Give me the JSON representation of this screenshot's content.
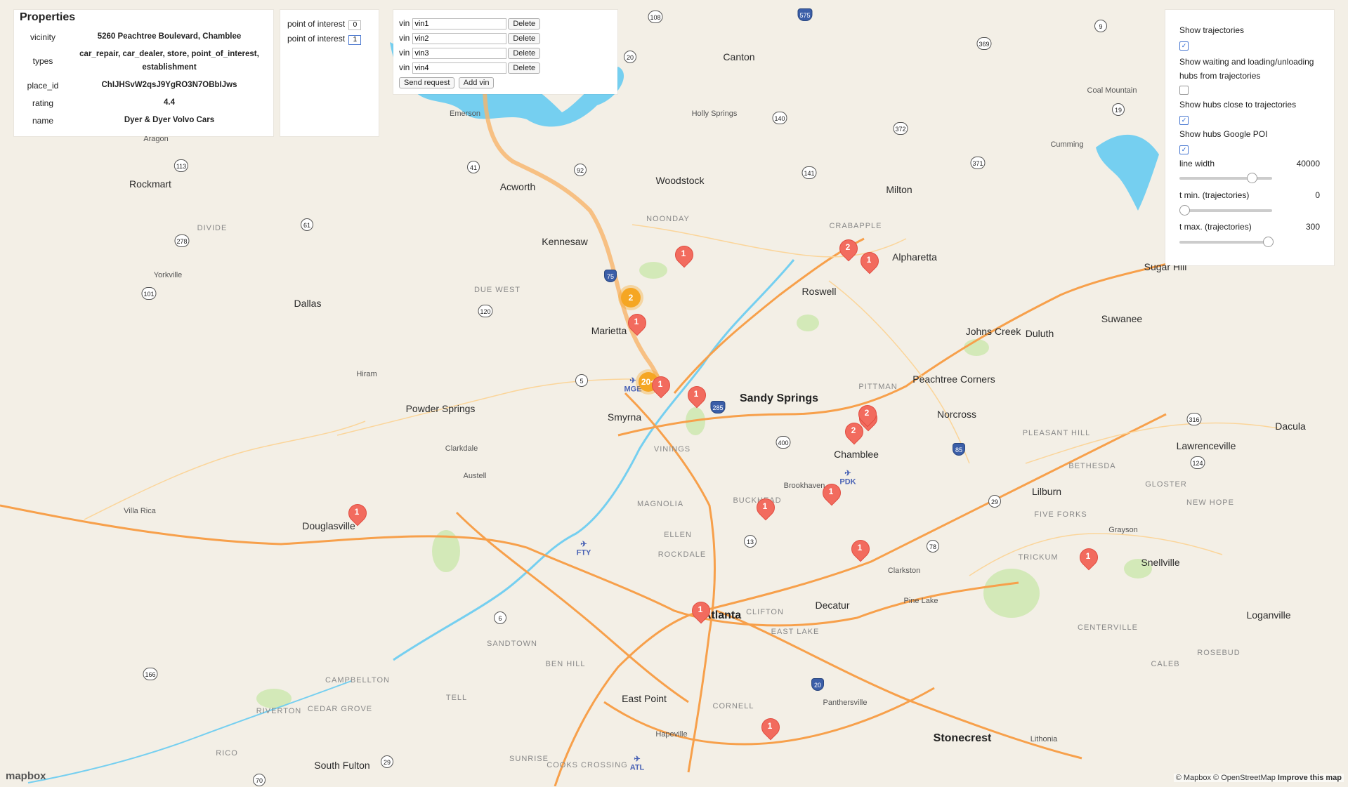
{
  "properties": {
    "title": "Properties",
    "rows": [
      {
        "key": "vicinity",
        "value": "5260 Peachtree Boulevard, Chamblee"
      },
      {
        "key": "types",
        "value": "car_repair, car_dealer, store, point_of_interest, establishment"
      },
      {
        "key": "place_id",
        "value": "ChIJHSvW2qsJ9YgRO3N7OBbIJws"
      },
      {
        "key": "rating",
        "value": "4.4"
      },
      {
        "key": "name",
        "value": "Dyer & Dyer Volvo Cars"
      }
    ]
  },
  "poi": {
    "label": "point of interest",
    "values": [
      "0",
      "1"
    ]
  },
  "vins": {
    "label": "vin",
    "items": [
      "vin1",
      "vin2",
      "vin3",
      "vin4"
    ],
    "delete_label": "Delete",
    "send_label": "Send request",
    "add_label": "Add vin"
  },
  "controls": {
    "show_trajectories": "Show trajectories",
    "show_waiting": "Show waiting and loading/unloading hubs from trajectories",
    "show_hubs_close": "Show hubs close to trajectories",
    "show_hubs_google": "Show hubs Google POI",
    "checked": [
      true,
      false,
      true,
      true
    ],
    "line_width_label": "line width",
    "line_width_value": "40000",
    "line_width_fraction": 0.81,
    "tmin_label": "t min. (trajectories)",
    "tmin_value": "0",
    "tmin_fraction": 0.0,
    "tmax_label": "t max. (trajectories)",
    "tmax_value": "300",
    "tmax_fraction": 1.0
  },
  "map": {
    "places_big": [
      "Sandy Springs",
      "Atlanta",
      "Stonecrest"
    ],
    "places_med": [
      "Marietta",
      "Kennesaw",
      "Smyrna",
      "Roswell",
      "Alpharetta",
      "Dallas",
      "Powder Springs",
      "Douglasville",
      "Chamblee",
      "Norcross",
      "Duluth",
      "Johns Creek",
      "Decatur",
      "East Point",
      "Lilburn",
      "Snellville",
      "Lawrenceville",
      "Dacula",
      "Suwanee",
      "Sugar Hill",
      "Woodstock",
      "Acworth",
      "Canton",
      "Milton",
      "Rockmart",
      "South Fulton",
      "Loganville",
      "Peachtree Corners"
    ],
    "places_sm": [
      "Hiram",
      "Clarkdale",
      "Austell",
      "Villa Rica",
      "Yorkville",
      "Aragon",
      "Emerson",
      "Holly Springs",
      "Cumming",
      "Coal Mountain",
      "Brookhaven",
      "Clarkston",
      "Pine Lake",
      "Hapeville",
      "Lithonia",
      "Panthersville",
      "Grayson"
    ],
    "hoods": [
      "Due West",
      "Noonday",
      "Crabapple",
      "Pittman",
      "Pleasant Hill",
      "Bethesda",
      "Gloster",
      "New Hope",
      "Five Forks",
      "Trickum",
      "Centerville",
      "Rosebud",
      "Caleb",
      "Buckhead",
      "Vinings",
      "Magnolia",
      "Ellen",
      "Rockdale",
      "Clifton",
      "East Lake",
      "Sandtown",
      "Ben Hill",
      "Campbellton",
      "Tell",
      "Cedar Grove",
      "Riverton",
      "Cornell",
      "Sunrise",
      "Cooks Crossing",
      "Rico",
      "Divide"
    ],
    "airports": [
      "MGE",
      "PDK",
      "FTY",
      "ATL"
    ],
    "markers": [
      "1",
      "2",
      "1",
      "2",
      "1",
      "1",
      "1",
      "2",
      "2",
      "1",
      "1",
      "1",
      "1",
      "1",
      "1",
      "1"
    ],
    "clusters": [
      "2",
      "20+"
    ],
    "shields": [
      "575",
      "108",
      "369",
      "9",
      "20",
      "140",
      "372",
      "371",
      "19",
      "141",
      "92",
      "41",
      "75",
      "278",
      "113",
      "61",
      "101",
      "120",
      "5",
      "400",
      "285",
      "85",
      "316",
      "124",
      "29",
      "78",
      "13",
      "166",
      "70",
      "29",
      "6",
      "20"
    ],
    "attribution": "© Mapbox © OpenStreetMap",
    "improve": "Improve this map",
    "logo": "mapbox"
  },
  "colors": {
    "land": "#f3efe6",
    "water": "#75cff0",
    "park": "#cfe8b3",
    "highway": "#f7a04b",
    "marker": "#f26b5e",
    "cluster": "#f5a623",
    "trajectory": "#f7b46a"
  }
}
